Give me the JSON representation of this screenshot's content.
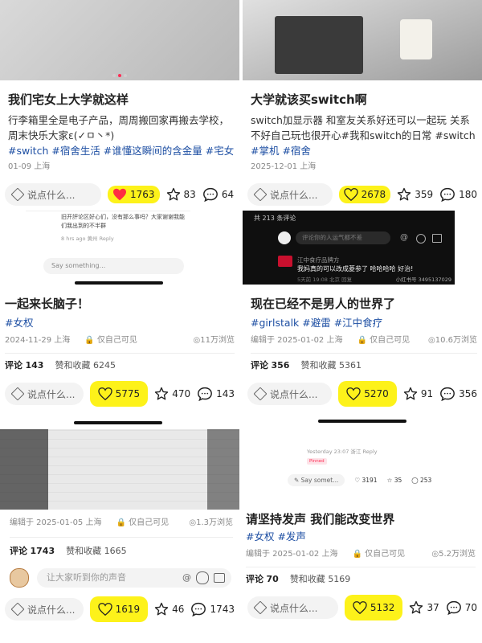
{
  "cells": {
    "c1": {
      "title": "我们宅女上大学就这样",
      "body": "行李箱里全是电子产品，周周搬回家再搬去学校，周末快乐大家ε(✓ㅁ丶*)",
      "tags": "#switch #宿舍生活 #谁懂这瞬间的含金量 #宅女",
      "meta": "01-09 上海",
      "say": "说点什么...",
      "likes": "1763",
      "stars": "83",
      "comments": "64",
      "comment_preview": "Say something...",
      "comment_lines": [
        "旧开評论区好心们，没有那么事吗？大家谢谢我能们我出到的不半群",
        "8 hrs ago 黄州 Reply"
      ]
    },
    "c2": {
      "title": "大学就该买switch啊",
      "body": "switch加显示器 和室友关系好还可以一起玩 关系不好自己玩也很开心#我和switch的日常 #switch",
      "tags": "#掌机 #宿舍",
      "meta": "2025-12-01 上海",
      "say": "说点什么...",
      "likes": "2678",
      "stars": "359",
      "comments": "180",
      "dark_header": "共 213 条评论",
      "dark_input": "评论你的人运气都不差",
      "dark_user": "江中食疗品牌方",
      "dark_comment": "我妈真的可以改成菱参了 哈哈哈哈 好治!",
      "dark_time": "5天前 19:08 北京 回复",
      "dark_watermark": "小红书号 3495137029"
    },
    "c3": {
      "title": "一起来长脑子！",
      "tags": "#女权",
      "date": "2024-11-29 上海",
      "visibility": "仅自己可见",
      "views": "11万浏览",
      "comments_label": "评论",
      "comments_count": "143",
      "likes_label": "赞和收藏",
      "likes_count": "6245",
      "say": "说点什么...",
      "likes": "5775",
      "stars": "470",
      "comments": "143"
    },
    "c4": {
      "title": "现在已经不是男人的世界了",
      "tags": "#girlstalk #避雷 #江中食疗",
      "date": "编辑于 2025-01-02 上海",
      "visibility": "仅自己可见",
      "views": "10.6万浏览",
      "comments_label": "评论",
      "comments_count": "356",
      "likes_label": "赞和收藏",
      "likes_count": "5361",
      "say": "说点什么...",
      "likes": "5270",
      "stars": "91",
      "comments": "356"
    },
    "c5": {
      "date": "编辑于 2025-01-05 上海",
      "visibility": "仅自己可见",
      "views": "1.3万浏览",
      "comments_label": "评论",
      "comments_count": "1743",
      "likes_label": "赞和收藏",
      "likes_count": "1665",
      "comment_placeholder": "让大家听到你的声音",
      "say": "说点什么...",
      "likes": "1619",
      "stars": "46",
      "comments": "1743"
    },
    "c6": {
      "mini_time": "Yesterday 23:07 浙江 Reply",
      "mini_badge": "Pinned",
      "mini_say": "Say somet...",
      "mini_likes": "3191",
      "mini_stars": "35",
      "mini_comments": "253",
      "title": "请坚持发声 我们能改变世界",
      "tags": "#女权 #发声",
      "date": "编辑于 2025-01-02 上海",
      "visibility": "仅自己可见",
      "views": "5.2万浏览",
      "comments_label": "评论",
      "comments_count": "70",
      "likes_label": "赞和收藏",
      "likes_count": "5169",
      "say": "说点什么...",
      "likes": "5132",
      "stars": "37",
      "comments": "70"
    }
  },
  "colors": {
    "highlight": "#fdf21a",
    "heart_red": "#ff2d42",
    "tag_blue": "#1e4fa3"
  }
}
